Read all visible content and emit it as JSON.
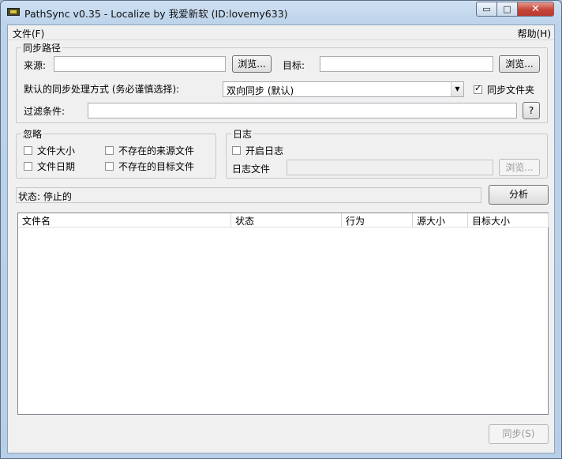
{
  "window": {
    "title": "PathSync v0.35  - Localize by 我爱新软   (ID:lovemy633)",
    "min_glyph": "▭",
    "max_glyph": "□",
    "close_glyph": "✕"
  },
  "menu": {
    "file": "文件(F)",
    "help": "帮助(H)"
  },
  "sync_paths": {
    "title": "同步路径",
    "source_label": "来源:",
    "source_value": "",
    "browse_source": "浏览...",
    "target_label": "目标:",
    "target_value": "",
    "browse_target": "浏览...",
    "default_mode_label": "默认的同步处理方式 (务必谨慎选择):",
    "default_mode_value": "双向同步 (默认)",
    "sync_folders_label": "同步文件夹",
    "sync_folders_checked": true,
    "filter_label": "过滤条件:",
    "filter_value": "",
    "filter_help": "?"
  },
  "ignore": {
    "title": "忽略",
    "file_size": "文件大小",
    "file_date": "文件日期",
    "missing_source": "不存在的来源文件",
    "missing_target": "不存在的目标文件"
  },
  "log": {
    "title": "日志",
    "enable_label": "开启日志",
    "file_label": "日志文件",
    "file_value": "",
    "browse": "浏览..."
  },
  "status": {
    "text": "状态: 停止的",
    "analyze": "分析"
  },
  "file_list": {
    "columns": [
      "文件名",
      "状态",
      "行为",
      "源大小",
      "目标大小"
    ]
  },
  "sync_button": "同步(S)"
}
